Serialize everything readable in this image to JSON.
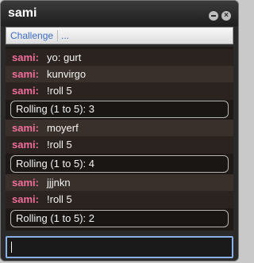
{
  "window": {
    "title": "sami",
    "controls": {
      "minimize_icon": "minimize-icon",
      "close_icon": "close-icon"
    }
  },
  "tabs": [
    {
      "label": "Challenge"
    },
    {
      "label": "..."
    }
  ],
  "chat": {
    "messages": [
      {
        "speaker": "sami:",
        "text": "yo: gurt"
      },
      {
        "speaker": "sami:",
        "text": "kunvirgo"
      },
      {
        "speaker": "sami:",
        "text": "!roll 5"
      },
      {
        "type": "roll",
        "text": "Rolling (1 to 5): 3"
      },
      {
        "speaker": "sami:",
        "text": "moyerf"
      },
      {
        "speaker": "sami:",
        "text": "!roll 5"
      },
      {
        "type": "roll",
        "text": "Rolling (1 to 5): 4"
      },
      {
        "speaker": "sami:",
        "text": "jjjnkn"
      },
      {
        "speaker": "sami:",
        "text": "!roll 5"
      },
      {
        "type": "roll",
        "text": "Rolling (1 to 5): 2"
      }
    ]
  },
  "input": {
    "value": "",
    "placeholder": ""
  },
  "colors": {
    "speaker": "#f06e9b",
    "tab_link": "#3d6cc6",
    "input_focus": "#8bb0e8"
  }
}
